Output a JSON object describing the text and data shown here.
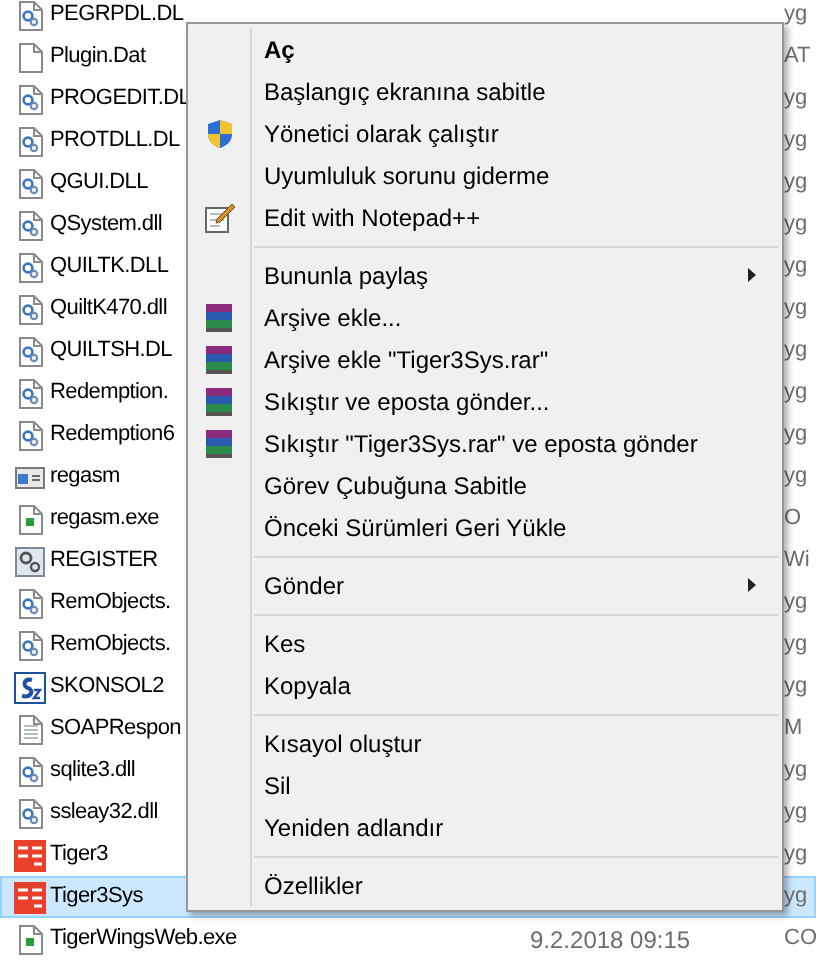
{
  "files": [
    {
      "name": "PEGRPDL.DL",
      "kind": "dll",
      "selected": false,
      "type": "yg"
    },
    {
      "name": "Plugin.Dat",
      "kind": "blank",
      "selected": false,
      "type": "AT"
    },
    {
      "name": "PROGEDIT.DL",
      "kind": "dll",
      "selected": false,
      "type": "yg"
    },
    {
      "name": "PROTDLL.DL",
      "kind": "dll",
      "selected": false,
      "type": "yg"
    },
    {
      "name": "QGUI.DLL",
      "kind": "dll",
      "selected": false,
      "type": "yg"
    },
    {
      "name": "QSystem.dll",
      "kind": "dll",
      "selected": false,
      "type": "yg"
    },
    {
      "name": "QUILTK.DLL",
      "kind": "dll",
      "selected": false,
      "type": "yg"
    },
    {
      "name": "QuiltK470.dll",
      "kind": "dll",
      "selected": false,
      "type": "yg"
    },
    {
      "name": "QUILTSH.DL",
      "kind": "dll",
      "selected": false,
      "type": "yg"
    },
    {
      "name": "Redemption.",
      "kind": "dll",
      "selected": false,
      "type": "yg"
    },
    {
      "name": "Redemption6",
      "kind": "dll",
      "selected": false,
      "type": "yg"
    },
    {
      "name": "regasm",
      "kind": "app",
      "selected": false,
      "type": "yg"
    },
    {
      "name": "regasm.exe",
      "kind": "exe",
      "selected": false,
      "type": "O"
    },
    {
      "name": "REGISTER",
      "kind": "register",
      "selected": false,
      "type": "Wi"
    },
    {
      "name": "RemObjects.",
      "kind": "dll",
      "selected": false,
      "type": "yg"
    },
    {
      "name": "RemObjects.",
      "kind": "dll",
      "selected": false,
      "type": "yg"
    },
    {
      "name": "SKONSOL2",
      "kind": "s2",
      "selected": false,
      "type": "yg"
    },
    {
      "name": "SOAPRespon",
      "kind": "doc",
      "selected": false,
      "type": "M"
    },
    {
      "name": "sqlite3.dll",
      "kind": "dll",
      "selected": false,
      "type": "yg"
    },
    {
      "name": "ssleay32.dll",
      "kind": "dll",
      "selected": false,
      "type": "yg"
    },
    {
      "name": "Tiger3",
      "kind": "tiger",
      "selected": false,
      "type": "yg"
    },
    {
      "name": "Tiger3Sys",
      "kind": "tiger",
      "selected": true,
      "type": "yg"
    },
    {
      "name": "TigerWingsWeb.exe",
      "kind": "exe",
      "selected": false,
      "date": "9.2.2018 09:15",
      "type": "CO"
    }
  ],
  "context_menu": [
    {
      "kind": "plain",
      "label": "Aç",
      "default": true,
      "submenu": false
    },
    {
      "kind": "plain",
      "label": "Başlangıç ekranına sabitle",
      "default": false,
      "submenu": false
    },
    {
      "kind": "shield",
      "label": "Yönetici olarak çalıştır",
      "default": false,
      "submenu": false
    },
    {
      "kind": "plain",
      "label": "Uyumluluk sorunu giderme",
      "default": false,
      "submenu": false
    },
    {
      "kind": "notepad",
      "label": "Edit with Notepad++",
      "default": false,
      "submenu": false
    },
    {
      "kind": "separator"
    },
    {
      "kind": "plain",
      "label": "Bununla paylaş",
      "default": false,
      "submenu": true
    },
    {
      "kind": "archive",
      "label": "Arşive ekle...",
      "default": false,
      "submenu": false
    },
    {
      "kind": "archive",
      "label": "Arşive ekle \"Tiger3Sys.rar\"",
      "default": false,
      "submenu": false
    },
    {
      "kind": "archive",
      "label": "Sıkıştır ve eposta gönder...",
      "default": false,
      "submenu": false
    },
    {
      "kind": "archive",
      "label": "Sıkıştır \"Tiger3Sys.rar\" ve eposta gönder",
      "default": false,
      "submenu": false
    },
    {
      "kind": "plain",
      "label": "Görev Çubuğuna Sabitle",
      "default": false,
      "submenu": false
    },
    {
      "kind": "plain",
      "label": "Önceki Sürümleri Geri Yükle",
      "default": false,
      "submenu": false
    },
    {
      "kind": "separator"
    },
    {
      "kind": "plain",
      "label": "Gönder",
      "default": false,
      "submenu": true
    },
    {
      "kind": "separator"
    },
    {
      "kind": "plain",
      "label": "Kes",
      "default": false,
      "submenu": false
    },
    {
      "kind": "plain",
      "label": "Kopyala",
      "default": false,
      "submenu": false
    },
    {
      "kind": "separator"
    },
    {
      "kind": "plain",
      "label": "Kısayol oluştur",
      "default": false,
      "submenu": false
    },
    {
      "kind": "plain",
      "label": "Sil",
      "default": false,
      "submenu": false
    },
    {
      "kind": "plain",
      "label": "Yeniden adlandır",
      "default": false,
      "submenu": false
    },
    {
      "kind": "separator"
    },
    {
      "kind": "plain",
      "label": "Özellikler",
      "default": false,
      "submenu": false
    }
  ]
}
